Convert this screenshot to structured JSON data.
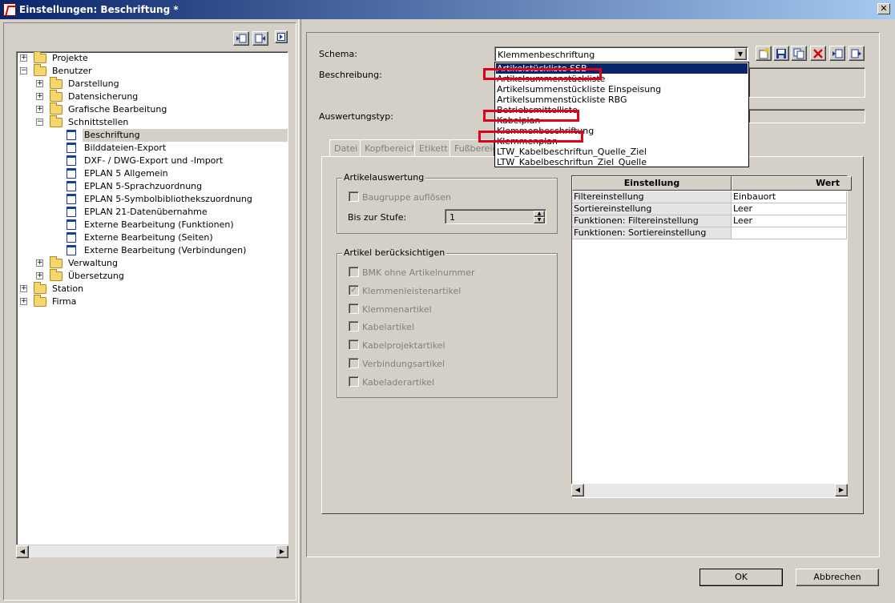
{
  "window": {
    "title": "Einstellungen: Beschriftung *",
    "close_glyph": "✕"
  },
  "toolbar_left": {
    "buttons": [
      "expand-icon",
      "collapse-icon",
      "next-icon"
    ]
  },
  "tree": {
    "items": [
      {
        "label": "Projekte",
        "icon": "folder-icon",
        "expander": "+"
      },
      {
        "label": "Benutzer",
        "icon": "folder-icon",
        "expander": "−"
      },
      {
        "label": "Darstellung",
        "icon": "folder-icon",
        "expander": "+"
      },
      {
        "label": "Datensicherung",
        "icon": "folder-icon",
        "expander": "+"
      },
      {
        "label": "Grafische Bearbeitung",
        "icon": "folder-icon",
        "expander": "+"
      },
      {
        "label": "Schnittstellen",
        "icon": "folder-icon",
        "expander": "−"
      },
      {
        "label": "Beschriftung",
        "icon": "document-icon",
        "expander": ""
      },
      {
        "label": "Bilddateien-Export",
        "icon": "document-icon",
        "expander": ""
      },
      {
        "label": "DXF- / DWG-Export und -Import",
        "icon": "document-icon",
        "expander": ""
      },
      {
        "label": "EPLAN 5 Allgemein",
        "icon": "document-icon",
        "expander": ""
      },
      {
        "label": "EPLAN 5-Sprachzuordnung",
        "icon": "document-icon",
        "expander": ""
      },
      {
        "label": "EPLAN 5-Symbolbibliothekszuordnung",
        "icon": "document-icon",
        "expander": ""
      },
      {
        "label": "EPLAN 21-Datenübernahme",
        "icon": "document-icon",
        "expander": ""
      },
      {
        "label": "Externe Bearbeitung (Funktionen)",
        "icon": "document-icon",
        "expander": ""
      },
      {
        "label": "Externe Bearbeitung (Seiten)",
        "icon": "document-icon",
        "expander": ""
      },
      {
        "label": "Externe Bearbeitung (Verbindungen)",
        "icon": "document-icon",
        "expander": ""
      },
      {
        "label": "Verwaltung",
        "icon": "folder-icon",
        "expander": "+"
      },
      {
        "label": "Übersetzung",
        "icon": "folder-icon",
        "expander": "+"
      },
      {
        "label": "Station",
        "icon": "folder-icon",
        "expander": "+"
      },
      {
        "label": "Firma",
        "icon": "folder-icon",
        "expander": "+"
      }
    ],
    "selected": "Beschriftung"
  },
  "form": {
    "schema_label": "Schema:",
    "schema_value": "Klemmenbeschriftung",
    "beschreibung_label": "Beschreibung:",
    "auswertungstyp_label": "Auswertungstyp:"
  },
  "dropdown": {
    "options": [
      "Artikelstückliste SSB",
      "Artikelsummenstückliste",
      "Artikelsummenstückliste Einspeisung",
      "Artikelsummenstückliste RBG",
      "Betriebsmittelliste",
      "Kabelplan",
      "Klemmenbeschriftung",
      "Klemmenplan",
      "LTW_Kabelbeschriftun_Quelle_Ziel",
      "LTW_Kabelbeschriftun_Ziel_Quelle"
    ],
    "highlighted": "Artikelstückliste SSB",
    "annotated": [
      "Artikelsummenstückliste",
      "Kabelplan",
      "Klemmenplan"
    ],
    "annotation_color": "#e0001a"
  },
  "schema_toolbar": [
    "new-icon",
    "save-icon",
    "copy-icon",
    "delete-icon",
    "import-icon",
    "export-icon"
  ],
  "tabs": [
    "Datei",
    "Kopfbereich",
    "Etikett",
    "Fußbereich"
  ],
  "artikelauswertung": {
    "title": "Artikelauswertung",
    "baugruppe_label": "Baugruppe auflösen",
    "stufe_label": "Bis zur Stufe:",
    "stufe_value": "1"
  },
  "artikel_beruecksichtigen": {
    "title": "Artikel berücksichtigen",
    "items": [
      {
        "label": "BMK ohne Artikelnummer",
        "checked": false
      },
      {
        "label": "Klemmenleistenartikel",
        "checked": true
      },
      {
        "label": "Klemmenartikel",
        "checked": false
      },
      {
        "label": "Kabelartikel",
        "checked": false
      },
      {
        "label": "Kabelprojektartikel",
        "checked": false
      },
      {
        "label": "Verbindungsartikel",
        "checked": false
      },
      {
        "label": "Kabeladerartikel",
        "checked": false
      }
    ]
  },
  "grid": {
    "headers": [
      "Einstellung",
      "Wert"
    ],
    "rows": [
      [
        "Filtereinstellung",
        "Einbauort"
      ],
      [
        "Sortiereinstellung",
        "Leer"
      ],
      [
        "Funktionen: Filtereinstellung",
        "Leer"
      ],
      [
        "Funktionen: Sortiereinstellung",
        ""
      ]
    ]
  },
  "buttons": {
    "ok": "OK",
    "cancel": "Abbrechen"
  }
}
